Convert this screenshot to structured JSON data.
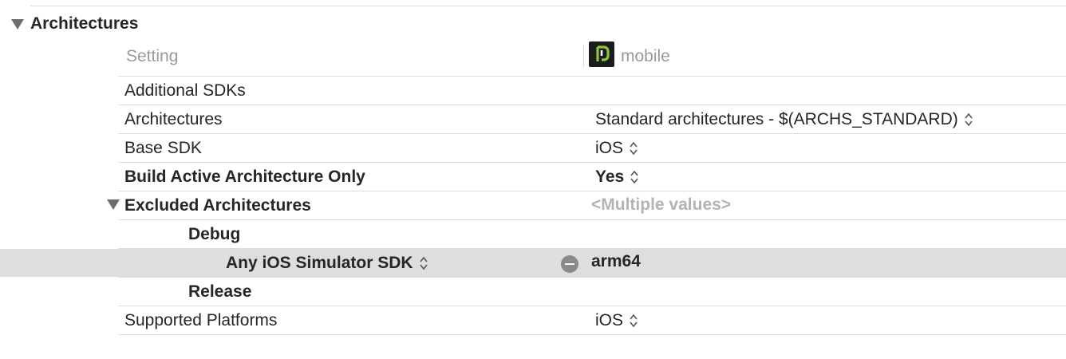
{
  "section": {
    "title": "Architectures",
    "column_setting": "Setting",
    "target_name": "mobile"
  },
  "rows": [
    {
      "label": "Additional SDKs",
      "value": ""
    },
    {
      "label": "Architectures",
      "value": "Standard architectures  -  $(ARCHS_STANDARD)"
    },
    {
      "label": "Base SDK",
      "value": "iOS"
    },
    {
      "label": "Build Active Architecture Only",
      "value": "Yes"
    },
    {
      "label": "Excluded Architectures",
      "value": "<Multiple values>"
    },
    {
      "label": "Debug",
      "value": ""
    },
    {
      "label": "Any iOS Simulator SDK",
      "value": "arm64"
    },
    {
      "label": "Release",
      "value": ""
    },
    {
      "label": "Supported Platforms",
      "value": "iOS"
    }
  ],
  "icons": {
    "section_toggle": "disclosure-triangle-icon",
    "target": "app-target-icon",
    "stepper": "up-down-stepper-icon",
    "remove": "minus-circle-icon"
  }
}
